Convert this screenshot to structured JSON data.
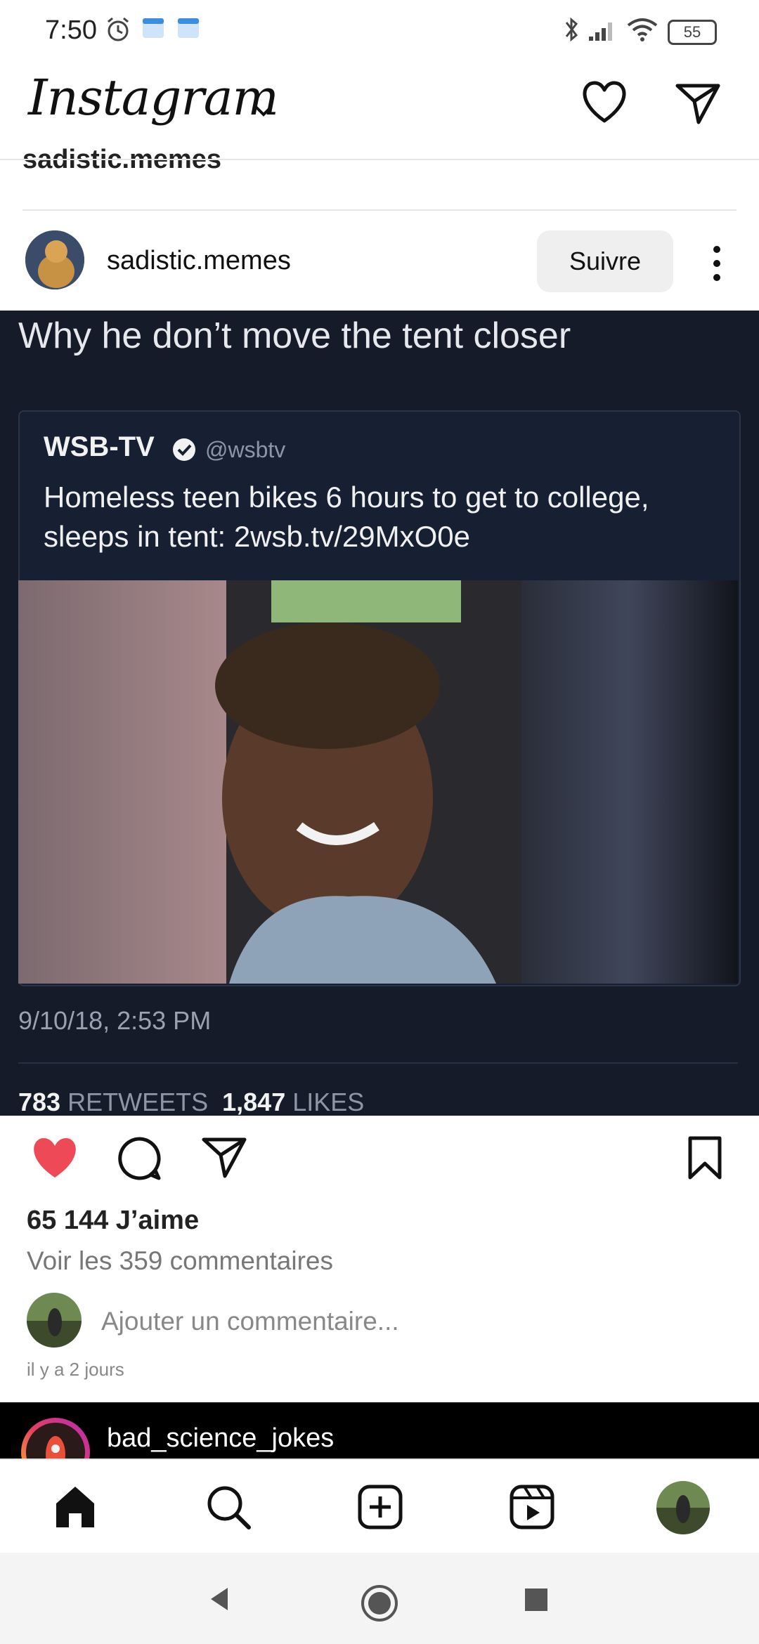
{
  "status_bar": {
    "time": "7:50",
    "battery": "55"
  },
  "header": {
    "logo": "Instagram",
    "icons": [
      "chevron-down-icon",
      "heart-icon",
      "direct-message-icon"
    ]
  },
  "previous_post": {
    "username": "sadistic.memes"
  },
  "post": {
    "username": "sadistic.memes",
    "follow_label": "Suivre",
    "image": {
      "caption": "Why he don’t move the tent closer",
      "tweet": {
        "name": "WSB-TV",
        "handle": "@wsbtv",
        "text": "Homeless teen bikes 6 hours to get to college, sleeps in tent: 2wsb.tv/29MxO0e",
        "date": "9/10/18, 2:53 PM",
        "retweets": "783",
        "retweets_label": "RETWEETS",
        "likes": "1,847",
        "likes_label": "LIKES"
      }
    },
    "likes_text": "65 144 J’aime",
    "view_comments": "Voir les 359 commentaires",
    "add_comment_placeholder": "Ajouter un commentaire...",
    "time_ago": "il y a 2 jours",
    "liked": true,
    "colors": {
      "like": "#ed4956"
    }
  },
  "next_post": {
    "username": "bad_science_jokes"
  },
  "bottom_nav": [
    "home-icon",
    "search-icon",
    "new-post-icon",
    "reels-icon",
    "profile-avatar"
  ],
  "system_nav": [
    "back-icon",
    "home-circle-icon",
    "recents-icon"
  ]
}
